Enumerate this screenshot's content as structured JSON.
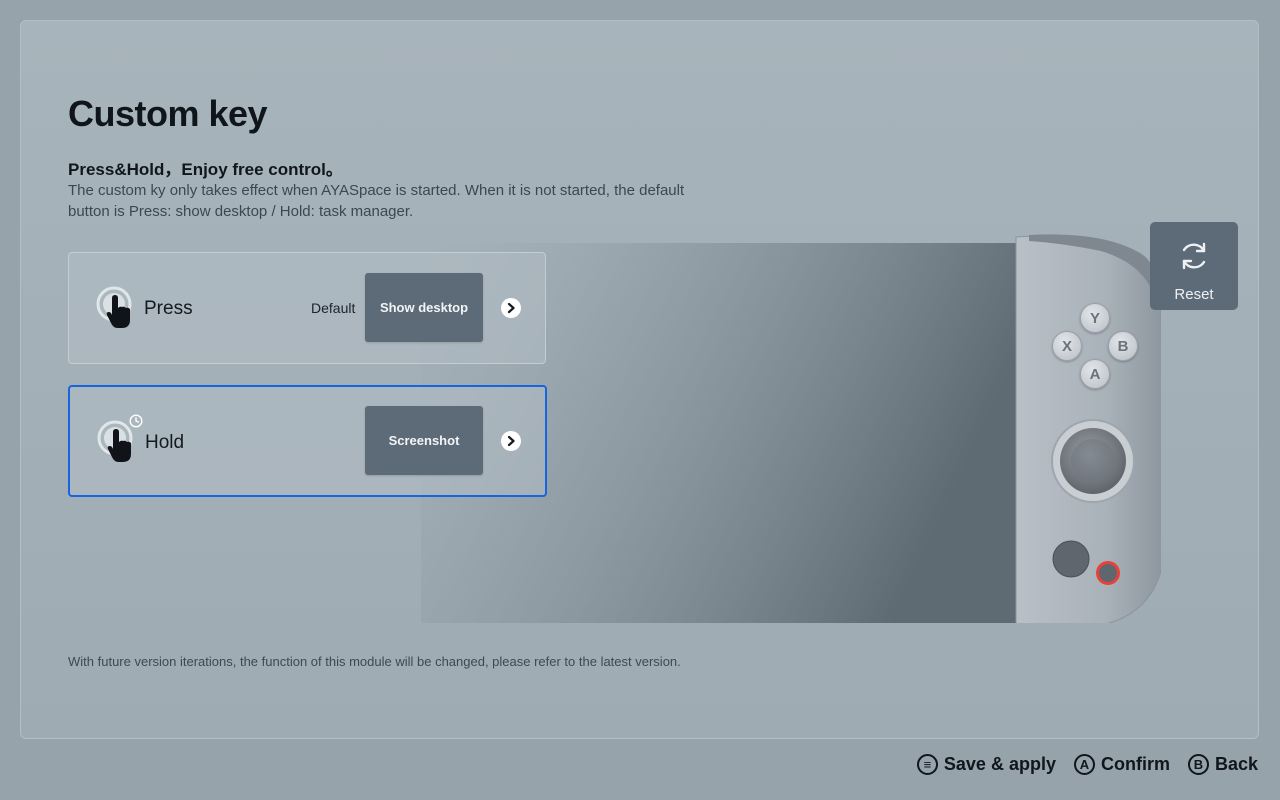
{
  "page": {
    "title": "Custom key",
    "subtitle": "Press&Hold，Enjoy free control。",
    "description": "The custom ky only takes effect when AYASpace is started. When it is not started, the default button is Press: show desktop / Hold: task manager.",
    "footnote": "With future version iterations, the function of this module will be changed, please refer to the latest version."
  },
  "cards": [
    {
      "label": "Press",
      "default_label": "Default",
      "action": "Show desktop",
      "icon": "tap-hand-icon",
      "selected": false
    },
    {
      "label": "Hold",
      "default_label": "",
      "action": "Screenshot",
      "icon": "hold-hand-icon",
      "selected": true
    }
  ],
  "device": {
    "face_buttons": {
      "top": "Y",
      "left": "X",
      "right": "B",
      "bottom": "A"
    }
  },
  "reset": {
    "label": "Reset",
    "icon": "refresh-icon"
  },
  "bottom_bar": [
    {
      "glyph": "≡",
      "label": "Save & apply",
      "icon": "menu-button-icon"
    },
    {
      "glyph": "A",
      "label": "Confirm",
      "icon": "a-button-icon"
    },
    {
      "glyph": "B",
      "label": "Back",
      "icon": "b-button-icon"
    }
  ],
  "colors": {
    "accent_selected": "#1565e0",
    "action_button": "#5d6a77",
    "background": "#96a3ab",
    "record_button_ring": "#e8413a"
  }
}
